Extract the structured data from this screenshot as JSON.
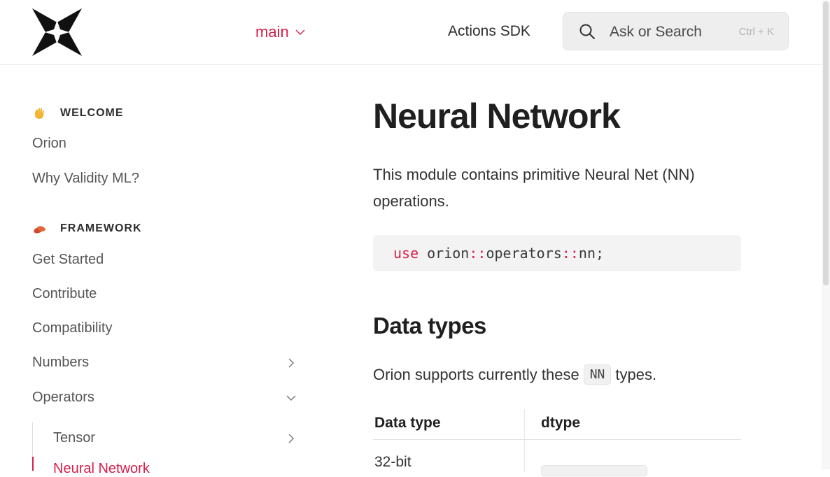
{
  "header": {
    "version_label": "main",
    "actions_link": "Actions SDK",
    "search": {
      "placeholder": "Ask or Search",
      "shortcut": "Ctrl + K"
    }
  },
  "sidebar": {
    "sections": [
      {
        "title": "WELCOME",
        "emoji": "waving-hand-icon",
        "items": [
          {
            "label": "Orion"
          },
          {
            "label": "Why Validity ML?"
          }
        ]
      },
      {
        "title": "FRAMEWORK",
        "emoji": "peanuts-icon",
        "items": [
          {
            "label": "Get Started"
          },
          {
            "label": "Contribute"
          },
          {
            "label": "Compatibility"
          },
          {
            "label": "Numbers",
            "expandable": true,
            "expanded": false
          },
          {
            "label": "Operators",
            "expandable": true,
            "expanded": true
          }
        ]
      }
    ],
    "operators_children": [
      {
        "label": "Tensor",
        "expandable": true,
        "expanded": false
      },
      {
        "label": "Neural Network",
        "active": true
      }
    ]
  },
  "content": {
    "title": "Neural Network",
    "intro": "This module contains primitive Neural Net (NN) operations.",
    "code": {
      "keyword": "use",
      "path_a": "orion",
      "sep": "::",
      "path_b": "operators",
      "path_c": "nn;"
    },
    "section_title": "Data types",
    "support_before": "Orion supports currently these",
    "support_code": "NN",
    "support_after": "types.",
    "table": {
      "headers": [
        "Data type",
        "dtype"
      ],
      "rows": [
        [
          "32-bit",
          ""
        ]
      ]
    }
  },
  "colors": {
    "accent": "#d6204b",
    "text": "#2e2e2e",
    "code_bg": "#f3f3f3"
  }
}
